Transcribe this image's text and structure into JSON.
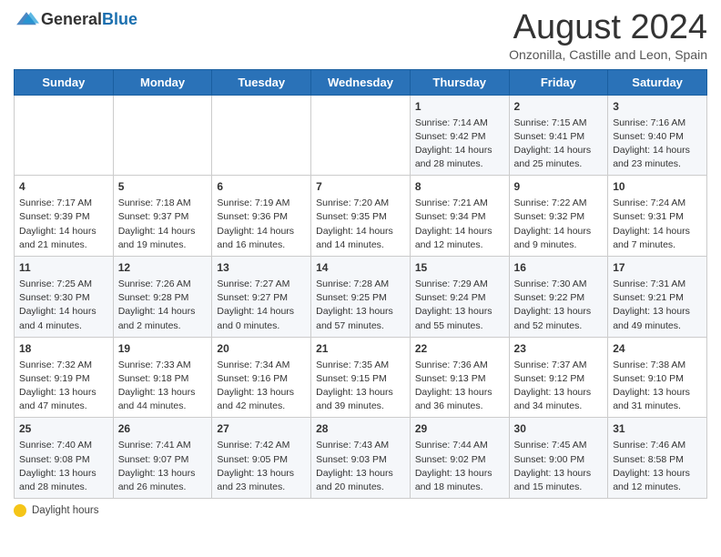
{
  "header": {
    "logo_general": "General",
    "logo_blue": "Blue",
    "title": "August 2024",
    "subtitle": "Onzonilla, Castille and Leon, Spain"
  },
  "days_of_week": [
    "Sunday",
    "Monday",
    "Tuesday",
    "Wednesday",
    "Thursday",
    "Friday",
    "Saturday"
  ],
  "weeks": [
    {
      "days": [
        {
          "num": "",
          "info": ""
        },
        {
          "num": "",
          "info": ""
        },
        {
          "num": "",
          "info": ""
        },
        {
          "num": "",
          "info": ""
        },
        {
          "num": "1",
          "info": "Sunrise: 7:14 AM\nSunset: 9:42 PM\nDaylight: 14 hours\nand 28 minutes."
        },
        {
          "num": "2",
          "info": "Sunrise: 7:15 AM\nSunset: 9:41 PM\nDaylight: 14 hours\nand 25 minutes."
        },
        {
          "num": "3",
          "info": "Sunrise: 7:16 AM\nSunset: 9:40 PM\nDaylight: 14 hours\nand 23 minutes."
        }
      ]
    },
    {
      "days": [
        {
          "num": "4",
          "info": "Sunrise: 7:17 AM\nSunset: 9:39 PM\nDaylight: 14 hours\nand 21 minutes."
        },
        {
          "num": "5",
          "info": "Sunrise: 7:18 AM\nSunset: 9:37 PM\nDaylight: 14 hours\nand 19 minutes."
        },
        {
          "num": "6",
          "info": "Sunrise: 7:19 AM\nSunset: 9:36 PM\nDaylight: 14 hours\nand 16 minutes."
        },
        {
          "num": "7",
          "info": "Sunrise: 7:20 AM\nSunset: 9:35 PM\nDaylight: 14 hours\nand 14 minutes."
        },
        {
          "num": "8",
          "info": "Sunrise: 7:21 AM\nSunset: 9:34 PM\nDaylight: 14 hours\nand 12 minutes."
        },
        {
          "num": "9",
          "info": "Sunrise: 7:22 AM\nSunset: 9:32 PM\nDaylight: 14 hours\nand 9 minutes."
        },
        {
          "num": "10",
          "info": "Sunrise: 7:24 AM\nSunset: 9:31 PM\nDaylight: 14 hours\nand 7 minutes."
        }
      ]
    },
    {
      "days": [
        {
          "num": "11",
          "info": "Sunrise: 7:25 AM\nSunset: 9:30 PM\nDaylight: 14 hours\nand 4 minutes."
        },
        {
          "num": "12",
          "info": "Sunrise: 7:26 AM\nSunset: 9:28 PM\nDaylight: 14 hours\nand 2 minutes."
        },
        {
          "num": "13",
          "info": "Sunrise: 7:27 AM\nSunset: 9:27 PM\nDaylight: 14 hours\nand 0 minutes."
        },
        {
          "num": "14",
          "info": "Sunrise: 7:28 AM\nSunset: 9:25 PM\nDaylight: 13 hours\nand 57 minutes."
        },
        {
          "num": "15",
          "info": "Sunrise: 7:29 AM\nSunset: 9:24 PM\nDaylight: 13 hours\nand 55 minutes."
        },
        {
          "num": "16",
          "info": "Sunrise: 7:30 AM\nSunset: 9:22 PM\nDaylight: 13 hours\nand 52 minutes."
        },
        {
          "num": "17",
          "info": "Sunrise: 7:31 AM\nSunset: 9:21 PM\nDaylight: 13 hours\nand 49 minutes."
        }
      ]
    },
    {
      "days": [
        {
          "num": "18",
          "info": "Sunrise: 7:32 AM\nSunset: 9:19 PM\nDaylight: 13 hours\nand 47 minutes."
        },
        {
          "num": "19",
          "info": "Sunrise: 7:33 AM\nSunset: 9:18 PM\nDaylight: 13 hours\nand 44 minutes."
        },
        {
          "num": "20",
          "info": "Sunrise: 7:34 AM\nSunset: 9:16 PM\nDaylight: 13 hours\nand 42 minutes."
        },
        {
          "num": "21",
          "info": "Sunrise: 7:35 AM\nSunset: 9:15 PM\nDaylight: 13 hours\nand 39 minutes."
        },
        {
          "num": "22",
          "info": "Sunrise: 7:36 AM\nSunset: 9:13 PM\nDaylight: 13 hours\nand 36 minutes."
        },
        {
          "num": "23",
          "info": "Sunrise: 7:37 AM\nSunset: 9:12 PM\nDaylight: 13 hours\nand 34 minutes."
        },
        {
          "num": "24",
          "info": "Sunrise: 7:38 AM\nSunset: 9:10 PM\nDaylight: 13 hours\nand 31 minutes."
        }
      ]
    },
    {
      "days": [
        {
          "num": "25",
          "info": "Sunrise: 7:40 AM\nSunset: 9:08 PM\nDaylight: 13 hours\nand 28 minutes."
        },
        {
          "num": "26",
          "info": "Sunrise: 7:41 AM\nSunset: 9:07 PM\nDaylight: 13 hours\nand 26 minutes."
        },
        {
          "num": "27",
          "info": "Sunrise: 7:42 AM\nSunset: 9:05 PM\nDaylight: 13 hours\nand 23 minutes."
        },
        {
          "num": "28",
          "info": "Sunrise: 7:43 AM\nSunset: 9:03 PM\nDaylight: 13 hours\nand 20 minutes."
        },
        {
          "num": "29",
          "info": "Sunrise: 7:44 AM\nSunset: 9:02 PM\nDaylight: 13 hours\nand 18 minutes."
        },
        {
          "num": "30",
          "info": "Sunrise: 7:45 AM\nSunset: 9:00 PM\nDaylight: 13 hours\nand 15 minutes."
        },
        {
          "num": "31",
          "info": "Sunrise: 7:46 AM\nSunset: 8:58 PM\nDaylight: 13 hours\nand 12 minutes."
        }
      ]
    }
  ],
  "footer": {
    "daylight_label": "Daylight hours"
  }
}
